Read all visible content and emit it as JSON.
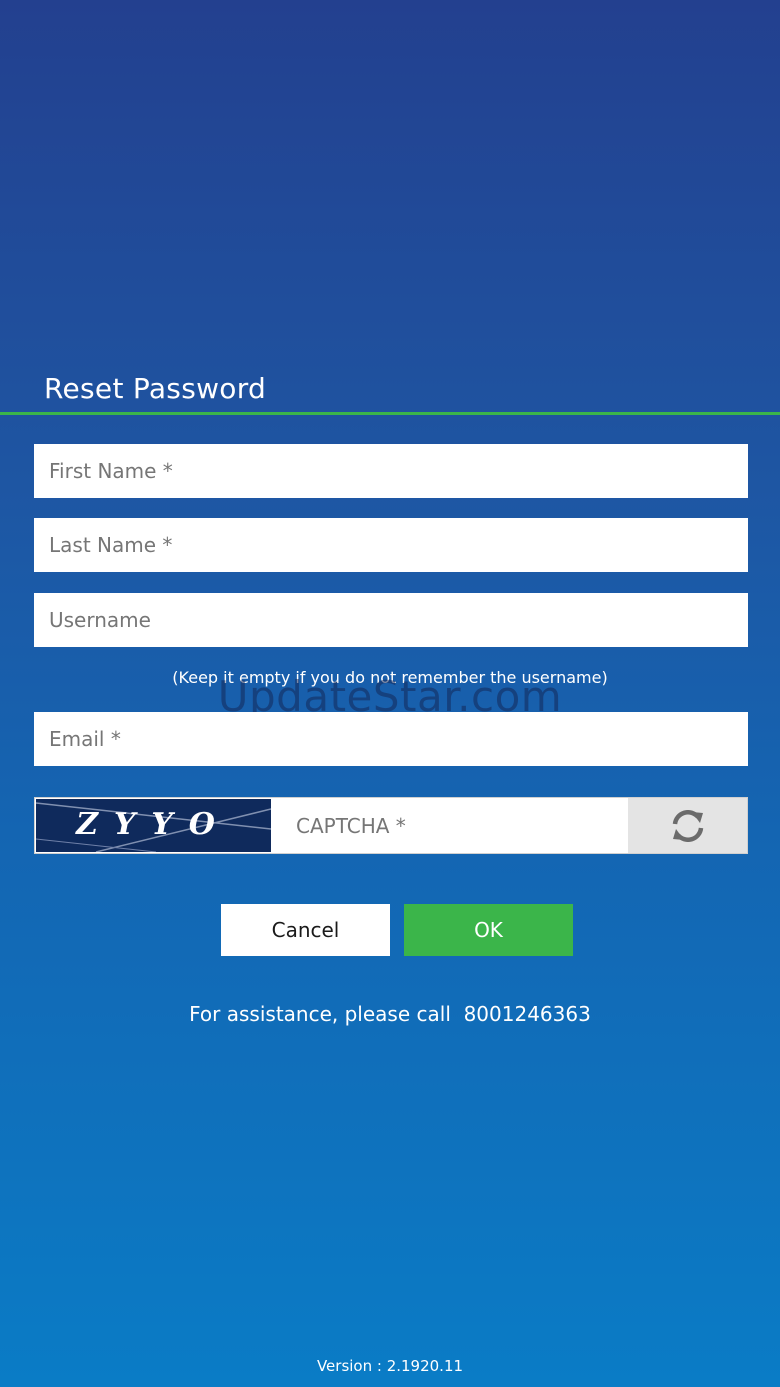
{
  "page": {
    "title": "Reset Password",
    "accent_color": "#3bb54a"
  },
  "form": {
    "first_name_placeholder": "First Name *",
    "last_name_placeholder": "Last Name *",
    "username_placeholder": "Username",
    "username_hint": "(Keep it empty if you do not remember the username)",
    "email_placeholder": "Email *",
    "captcha_code": "ZYYO",
    "captcha_placeholder": "CAPTCHA *",
    "refresh_icon": "refresh-icon"
  },
  "buttons": {
    "cancel_label": "Cancel",
    "ok_label": "OK"
  },
  "footer": {
    "assistance_text": "For assistance, please call  8001246363",
    "version_text": "Version : 2.1920.11"
  },
  "watermark": "UpdateStar.com"
}
